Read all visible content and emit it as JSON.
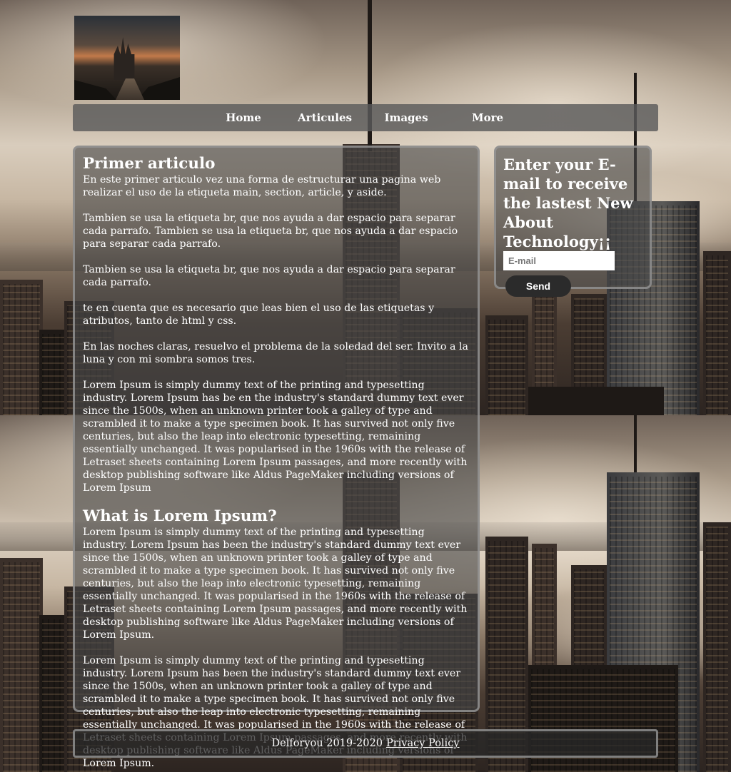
{
  "nav": {
    "items": [
      {
        "label": "Home"
      },
      {
        "label": "Articules"
      },
      {
        "label": "Images"
      },
      {
        "label": "More"
      }
    ]
  },
  "main": {
    "article1": {
      "title": "Primer articulo",
      "paragraphs": [
        "En este primer articulo vez una forma de estructurar una pagina web realizar el uso de la etiqueta main, section, article, y aside.",
        "Tambien se usa la etiqueta br, que nos ayuda a dar espacio para separar cada parrafo. Tambien se usa la etiqueta br, que nos ayuda a dar espacio para separar cada parrafo.",
        "Tambien se usa la etiqueta br, que nos ayuda a dar espacio para separar cada parrafo.",
        "te en cuenta que es necesario que leas bien el uso de las etiquetas y atributos, tanto de html y css.",
        "En las noches claras, resuelvo el problema de la soledad del ser. Invito a la luna y con mi sombra somos tres.",
        "Lorem Ipsum is simply dummy text of the printing and typesetting industry. Lorem Ipsum has be en the industry's standard dummy text ever since the 1500s, when an unknown printer took a galley of type and scrambled it to make a type specimen book. It has survived not only five centuries, but also the leap into electronic typesetting, remaining essentially unchanged. It was popularised in the 1960s with the release of Letraset sheets containing Lorem Ipsum passages, and more recently with desktop publishing software like Aldus PageMaker including versions of Lorem Ipsum"
      ]
    },
    "article2": {
      "title": "What is Lorem Ipsum?",
      "paragraphs": [
        "Lorem Ipsum is simply dummy text of the printing and typesetting industry. Lorem Ipsum has been the industry's standard dummy text ever since the 1500s, when an unknown printer took a galley of type and scrambled it to make a type specimen book. It has survived not only five centuries, but also the leap into electronic typesetting, remaining essentially unchanged. It was popularised in the 1960s with the release of Letraset sheets containing Lorem Ipsum passages, and more recently with desktop publishing software like Aldus PageMaker including versions of Lorem Ipsum.",
        "Lorem Ipsum is simply dummy text of the printing and typesetting industry. Lorem Ipsum has been the industry's standard dummy text ever since the 1500s, when an unknown printer took a galley of type and scrambled it to make a type specimen book. It has survived not only five centuries, but also the leap into electronic typesetting, remaining essentially unchanged. It was popularised in the 1960s with the release of Letraset sheets containing Lorem Ipsum passages, and more recently with desktop publishing software like Aldus PageMaker including versions of Lorem Ipsum."
      ]
    }
  },
  "aside": {
    "heading": "Enter your E-mail to receive the lastest New About Technology¡¡",
    "email_placeholder": "E-mail",
    "email_value": "",
    "send_label": "Send"
  },
  "footer": {
    "copyright": "Delforyou 2019-2020",
    "privacy_label": "Privacy Policy"
  },
  "colors": {
    "panel_background": "#484848",
    "panel_border": "#969696",
    "nav_background": "#5a5a5a",
    "button_background": "#2b2b2b",
    "text": "#ffffff"
  }
}
